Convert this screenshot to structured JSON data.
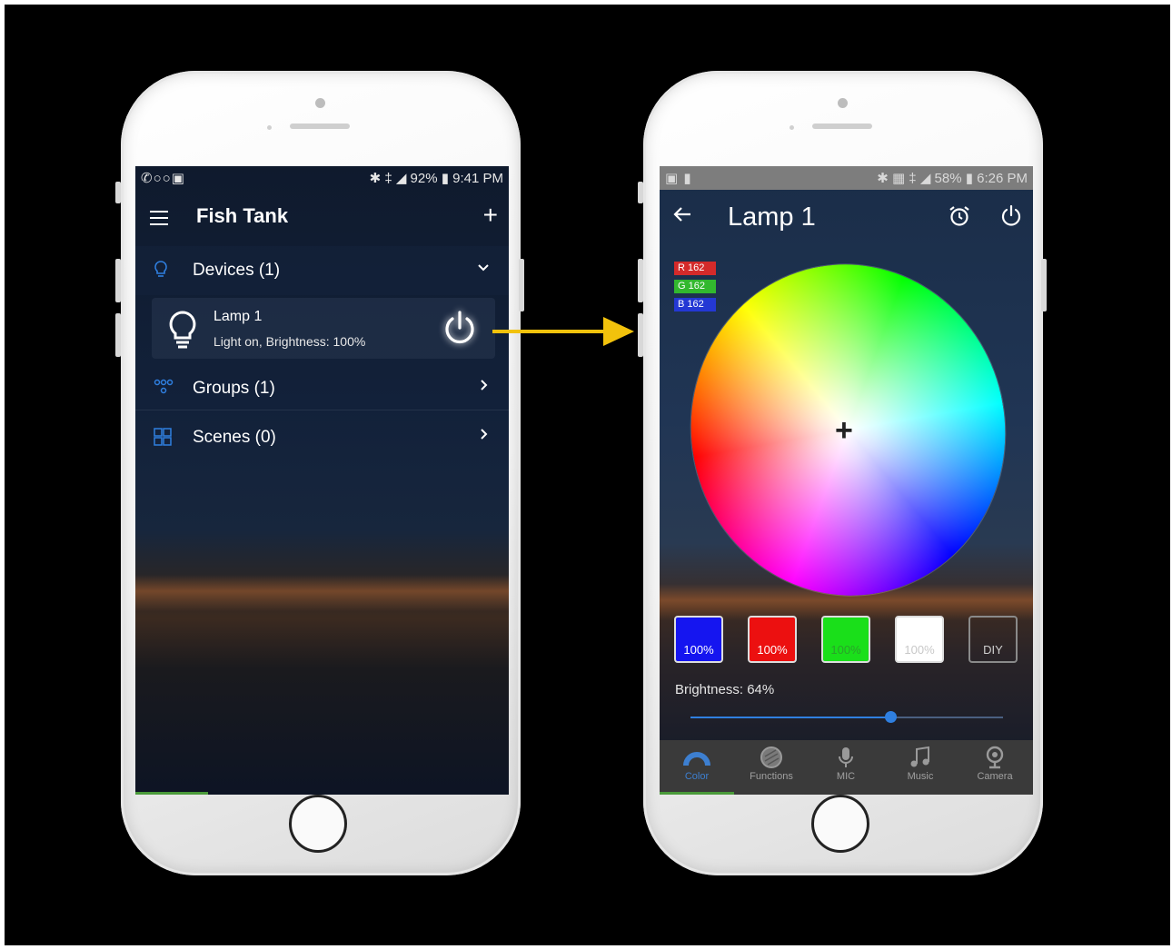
{
  "left_phone": {
    "statusbar": {
      "left_icons": "✆○○▣",
      "right": "✱ ‡ ◢ 92% ▮ 9:41 PM"
    },
    "title": "Fish Tank",
    "add_icon": "+",
    "devices_row": {
      "label": "Devices (1)"
    },
    "device": {
      "name": "Lamp 1",
      "status": "Light on, Brightness: 100%"
    },
    "groups_row": {
      "label": "Groups (1)"
    },
    "scenes_row": {
      "label": "Scenes (0)"
    }
  },
  "right_phone": {
    "statusbar": {
      "left_icons": "▣ ▮",
      "right": "✱ ▦ ‡ ◢ 58% ▮ 6:26 PM"
    },
    "title": "Lamp 1",
    "rgb": {
      "r": "R 162",
      "g": "G 162",
      "b": "B 162"
    },
    "swatches": [
      {
        "label": "100%",
        "color": "#1515f0"
      },
      {
        "label": "100%",
        "color": "#ec1010"
      },
      {
        "label": "100%",
        "color": "#1adf1a"
      },
      {
        "label": "100%",
        "color": "#ffffff"
      },
      {
        "label": "DIY"
      }
    ],
    "brightness_label": "Brightness: 64%",
    "brightness_value": 64,
    "nav": [
      {
        "label": "Color",
        "icon": "color-icon",
        "active": true
      },
      {
        "label": "Functions",
        "icon": "functions-icon"
      },
      {
        "label": "MIC",
        "icon": "mic-icon"
      },
      {
        "label": "Music",
        "icon": "music-icon"
      },
      {
        "label": "Camera",
        "icon": "camera-icon"
      }
    ]
  },
  "colors": {
    "accent": "#2f7fe0",
    "arrow": "#f2c20c"
  }
}
